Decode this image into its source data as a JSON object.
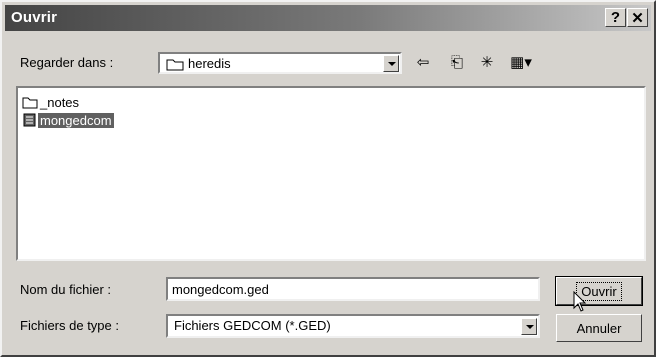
{
  "window": {
    "title": "Ouvrir",
    "help_label": "?",
    "close_label": "✕"
  },
  "lookin": {
    "label": "Regarder dans :",
    "value": "heredis"
  },
  "toolbar": {
    "back_icon": "⇦",
    "up_icon": "⎗",
    "newfolder_icon": "✳",
    "views_icon": "▦▾"
  },
  "files": [
    {
      "name": "_notes",
      "icon": "folder-icon",
      "selected": false
    },
    {
      "name": "mongedcom",
      "icon": "document-icon",
      "selected": true
    }
  ],
  "filename": {
    "label": "Nom du fichier :",
    "value": "mongedcom.ged"
  },
  "filetype": {
    "label": "Fichiers de type :",
    "value": "Fichiers GEDCOM (*.GED)"
  },
  "buttons": {
    "open": "Ouvrir",
    "cancel": "Annuler"
  }
}
